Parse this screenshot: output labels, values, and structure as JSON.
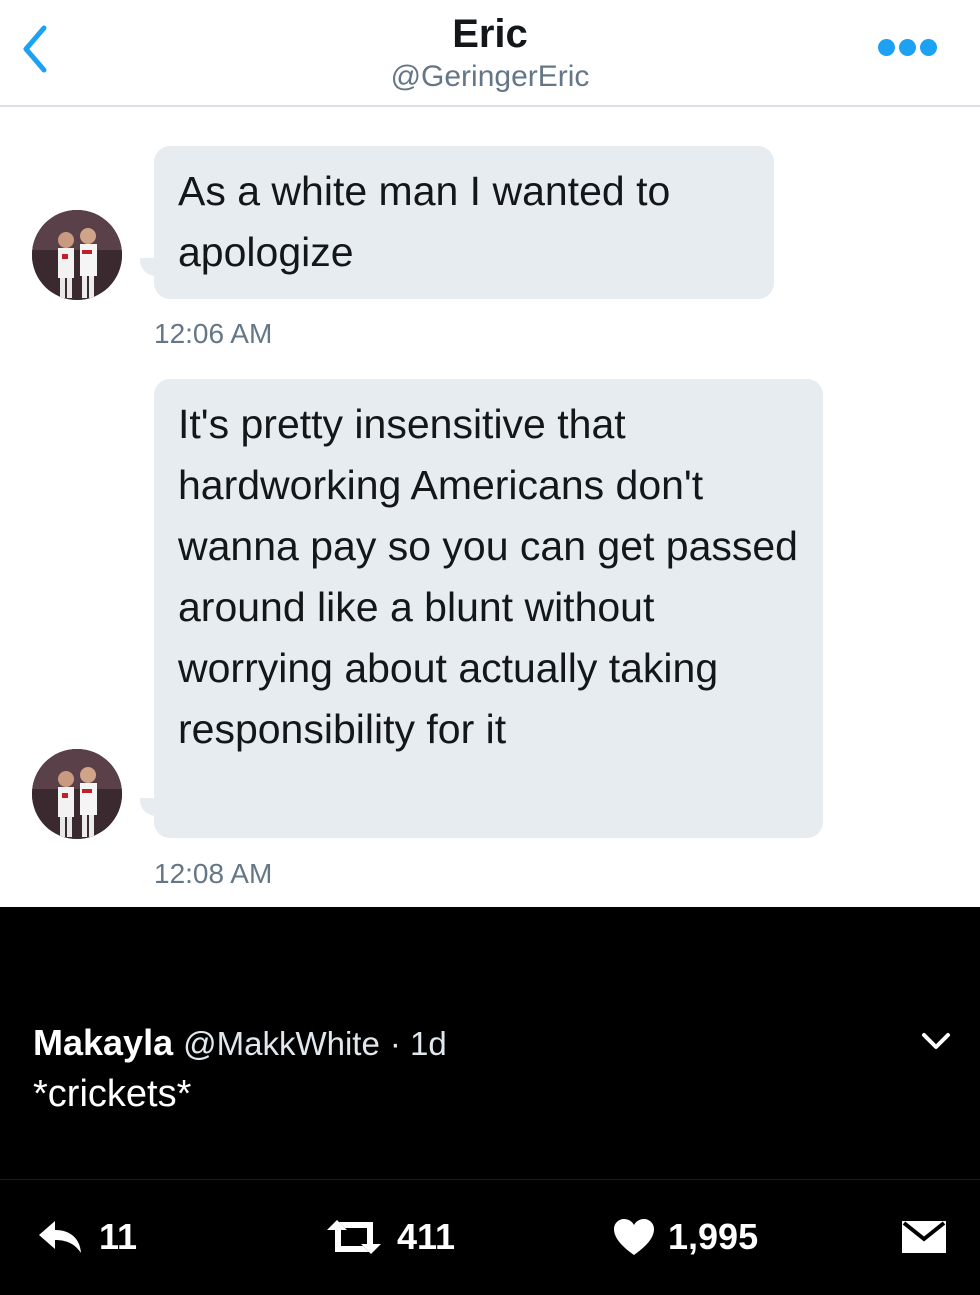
{
  "header": {
    "name": "Eric",
    "handle": "@GeringerEric"
  },
  "messages": [
    {
      "text": "As a white man I wanted to apologize",
      "time": "12:06 AM"
    },
    {
      "text": "It's pretty insensitive that hardworking Americans don't wanna pay so you can get passed around like a blunt without worrying about actually taking responsibility for it",
      "time": "12:08 AM"
    }
  ],
  "tweet": {
    "name": "Makayla",
    "handle": "@MakkWhite",
    "age": "· 1d",
    "text": "*crickets*"
  },
  "actions": {
    "replies": "11",
    "retweets": "411",
    "likes": "1,995"
  },
  "colors": {
    "accent": "#1da1f2",
    "bubble": "#e6ecf0",
    "muted": "#657786"
  },
  "icons": [
    "back-chevron-icon",
    "more-dots-icon",
    "chevron-down-icon",
    "reply-icon",
    "retweet-icon",
    "heart-icon",
    "direct-message-icon"
  ]
}
